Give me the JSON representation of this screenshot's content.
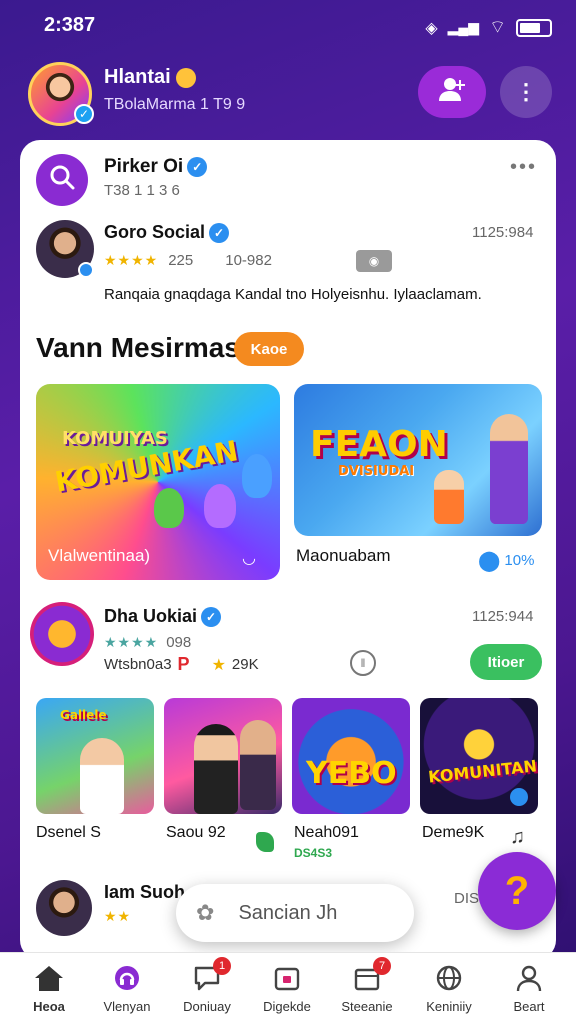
{
  "status_bar": {
    "time": "2:387"
  },
  "header": {
    "name": "Hlantai",
    "subtitle": "TBolaMarma 1 T9 9"
  },
  "feed": {
    "top_item": {
      "name": "Pirker Oi",
      "meta": "T38 1 1 3 6"
    },
    "post": {
      "author": "Goro Social",
      "time": "1125:984",
      "stars": "★★★★",
      "rating": "225",
      "views": "10-982",
      "body": "Ranqaia gnaqdaga Kandal tno Holyeisnhu. Iylaaclamam."
    },
    "section": {
      "title": "Vann Mesirmas",
      "pill": "Kaoe"
    },
    "featured": [
      {
        "art_line1": "KOMUIYAS",
        "art_line2": "KOMUNKAN",
        "caption": "Vlalwentinaa)"
      },
      {
        "art_line1": "FEAON",
        "art_line2": "DVISIUDAI",
        "caption": "Maonuabam",
        "stat": "10%"
      }
    ],
    "second_post": {
      "author": "Dha Uokiai",
      "time": "1125:944",
      "stars": "★★★★",
      "rating": "098",
      "sub": "Wtsbn0a3",
      "likes": "29K",
      "action": "Itioer"
    },
    "thumbnails": [
      {
        "label": "Dsenel S",
        "art": "Gallele"
      },
      {
        "label": "Saou 92",
        "art": ""
      },
      {
        "label": "Neah091",
        "sub": "DS4S3",
        "art": "YEBO"
      },
      {
        "label": "Deme9K",
        "art": "KOMUNITAN"
      }
    ],
    "third_post": {
      "author": "Iam Suoh",
      "right": "DIS"
    }
  },
  "search_pill": {
    "placeholder": "Sancian Jh"
  },
  "nav": [
    {
      "label": "Heoa",
      "icon": "home-icon"
    },
    {
      "label": "Vlenyan",
      "icon": "headset-icon"
    },
    {
      "label": "Doniuay",
      "icon": "chat-icon",
      "badge": "1"
    },
    {
      "label": "Digekde",
      "icon": "calendar-icon"
    },
    {
      "label": "Steeanie",
      "icon": "store-icon",
      "badge": "7"
    },
    {
      "label": "Keniniiy",
      "icon": "globe-icon"
    },
    {
      "label": "Beart",
      "icon": "user-icon"
    }
  ],
  "colors": {
    "primary": "#8a2bd2",
    "accent_orange": "#f48a1f",
    "accent_green": "#3ac060"
  }
}
